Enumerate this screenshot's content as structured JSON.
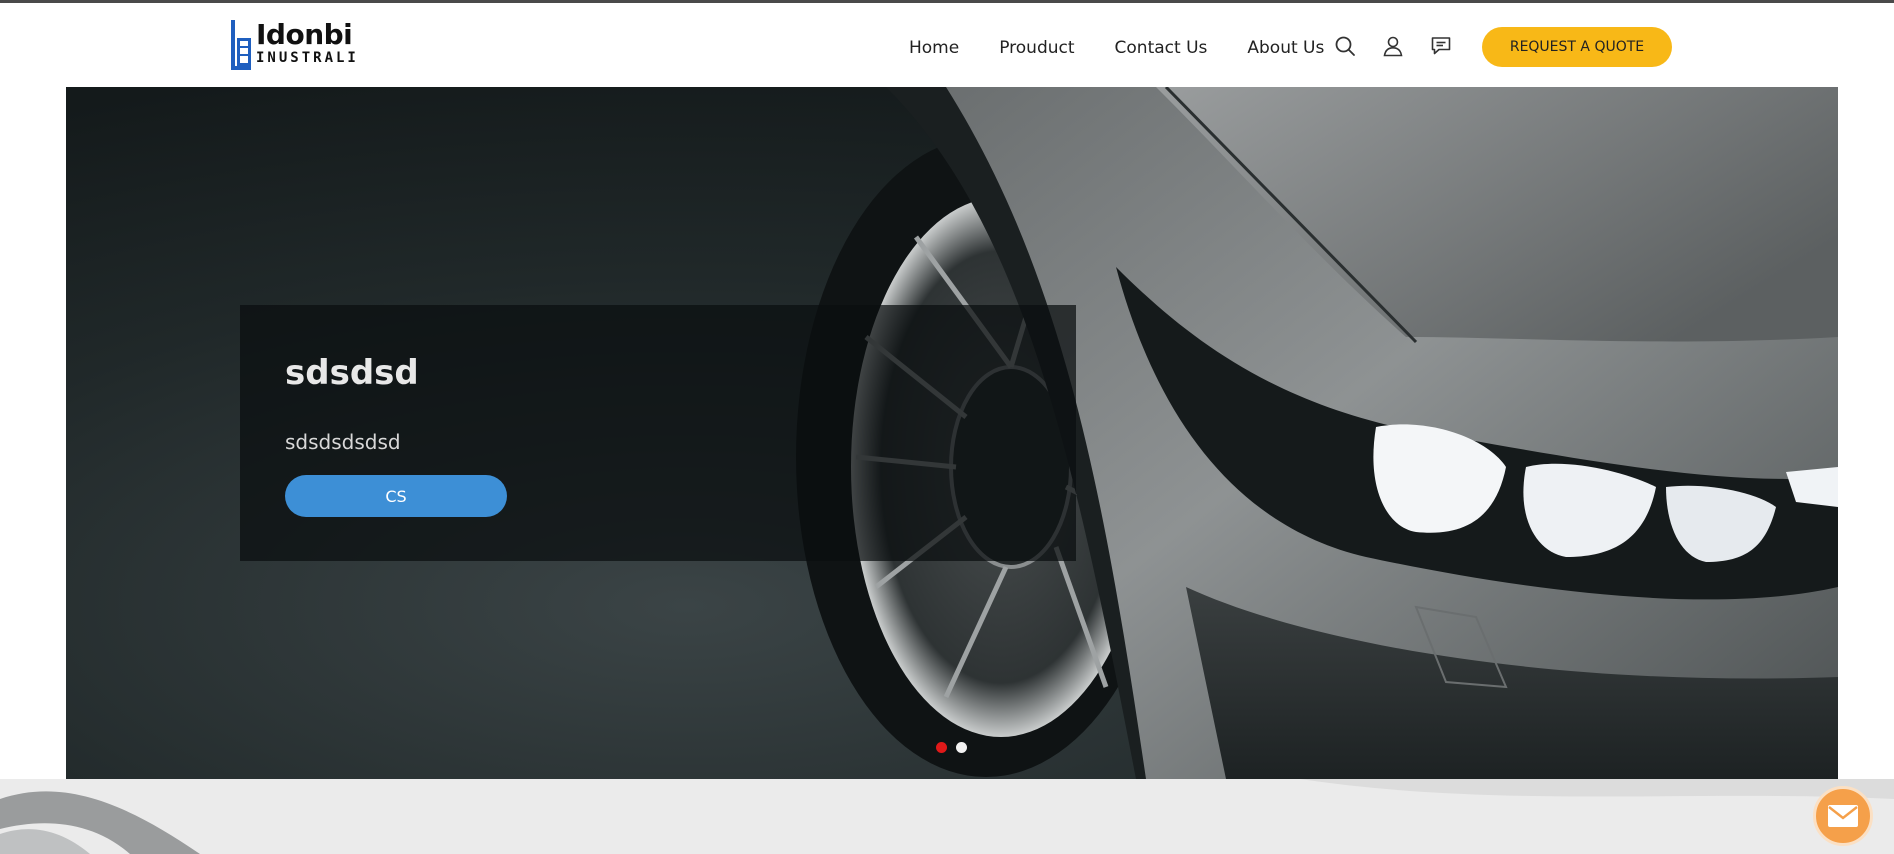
{
  "brand": {
    "name": "Idonbi",
    "subtitle": "INUSTRALI",
    "logo_icon": "building-logo-icon",
    "accent_color": "#1f5fbf"
  },
  "nav": {
    "items": [
      {
        "label": "Home"
      },
      {
        "label": "Prouduct"
      },
      {
        "label": "Contact Us"
      },
      {
        "label": "About Us"
      }
    ],
    "icons": [
      "search-icon",
      "user-icon",
      "chat-icon"
    ],
    "quote_button": "REQUEST A QUOTE",
    "quote_color": "#f8b817"
  },
  "hero": {
    "title": "sdsdsd",
    "text": "sdsdsdsdsd",
    "button_label": "CS",
    "button_color": "#3d8fd6",
    "slides": 2,
    "active_slide": 1,
    "active_dot_color": "#e01919"
  },
  "floating": {
    "icon": "mail-icon",
    "color": "#f5a04a"
  }
}
